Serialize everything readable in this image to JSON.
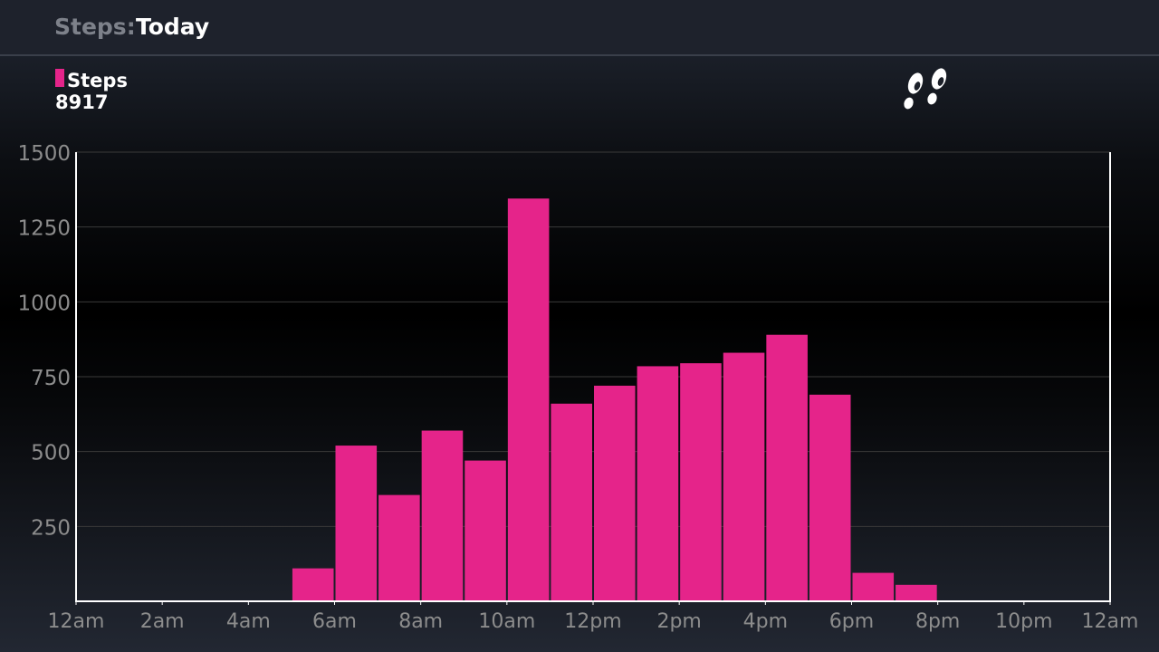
{
  "header": {
    "label": "Steps:",
    "value": "Today"
  },
  "legend": {
    "label": "Steps",
    "total": "8917"
  },
  "icons": {
    "activity": "footprints-icon"
  },
  "colors": {
    "bar": "#e5248a",
    "axis": "#ffffff",
    "grid": "#3a3a3a",
    "tick_text": "#8c8c8c"
  },
  "chart_data": {
    "type": "bar",
    "title": "",
    "xlabel": "",
    "ylabel": "",
    "x_tick_labels": [
      "12am",
      "2am",
      "4am",
      "6am",
      "8am",
      "10am",
      "12pm",
      "2pm",
      "4pm",
      "6pm",
      "8pm",
      "10pm",
      "12am"
    ],
    "y_ticks": [
      250,
      500,
      750,
      1000,
      1250,
      1500
    ],
    "ylim": [
      0,
      1500
    ],
    "hours": [
      0,
      1,
      2,
      3,
      4,
      5,
      6,
      7,
      8,
      9,
      10,
      11,
      12,
      13,
      14,
      15,
      16,
      17,
      18,
      19,
      20,
      21,
      22,
      23
    ],
    "values": [
      0,
      0,
      0,
      0,
      0,
      110,
      520,
      355,
      570,
      470,
      1345,
      660,
      720,
      785,
      795,
      830,
      890,
      690,
      95,
      55,
      0,
      0,
      0,
      0
    ],
    "series": [
      {
        "name": "Steps",
        "values": [
          0,
          0,
          0,
          0,
          0,
          110,
          520,
          355,
          570,
          470,
          1345,
          660,
          720,
          785,
          795,
          830,
          890,
          690,
          95,
          55,
          0,
          0,
          0,
          0
        ]
      }
    ],
    "grid": true
  }
}
